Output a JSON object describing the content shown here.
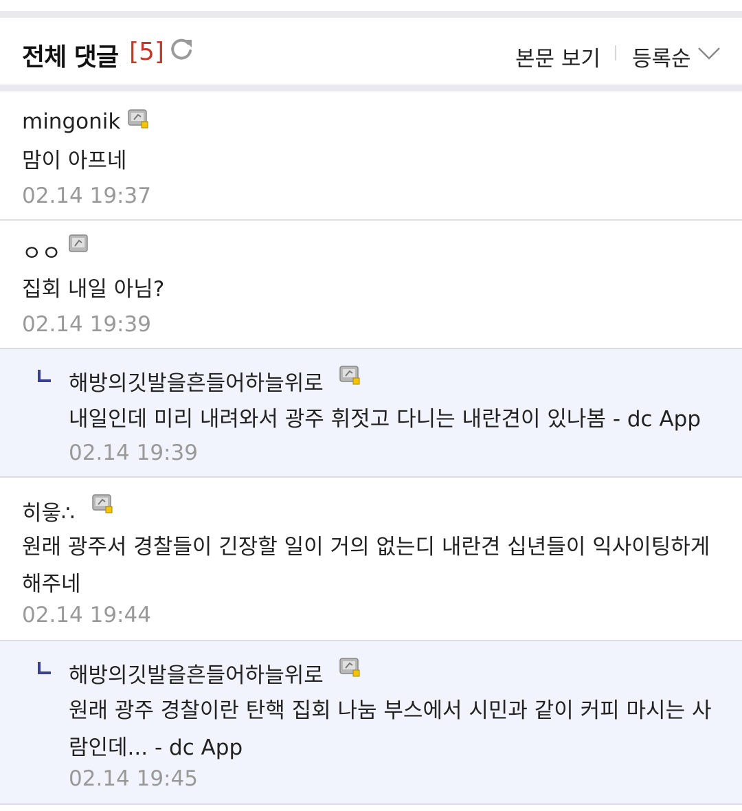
{
  "header": {
    "title": "전체 댓글",
    "count": "[5]",
    "refresh_icon": "refresh-icon",
    "view_post_label": "본문 보기",
    "sort_label": "등록순",
    "sort_icon": "chevron-down-icon"
  },
  "colors": {
    "count": "#c0392b",
    "reply_background": "#f1f4fc",
    "reply_arrow": "#3a3f8f",
    "date": "#999999"
  },
  "comments": [
    {
      "author": "mingonik",
      "badge": "user-badge-icon",
      "text": "맘이 아프네",
      "date": "02.14 19:37",
      "reply": false
    },
    {
      "author": "ㅇㅇ",
      "badge": "user-badge-icon",
      "text": "집회 내일 아님?",
      "date": "02.14 19:39",
      "reply": false
    },
    {
      "author": "해방의깃발을흔들어하늘위로",
      "badge": "user-badge-icon",
      "text": "내일인데 미리 내려와서 광주 휘젓고 다니는 내란견이 있나봄 - dc App",
      "date": "02.14 19:39",
      "reply": true
    },
    {
      "author": "히읗∴",
      "badge": "user-badge-icon",
      "text": "원래 광주서 경찰들이 긴장할 일이 거의 없는디 내란견 십년들이 익사이팅하게 해주네",
      "date": "02.14 19:44",
      "reply": false
    },
    {
      "author": "해방의깃발을흔들어하늘위로",
      "badge": "user-badge-icon",
      "text": "원래 광주 경찰이란 탄핵 집회 나눔 부스에서 시민과 같이 커피 마시는 사람인데... - dc App",
      "date": "02.14 19:45",
      "reply": true
    }
  ]
}
